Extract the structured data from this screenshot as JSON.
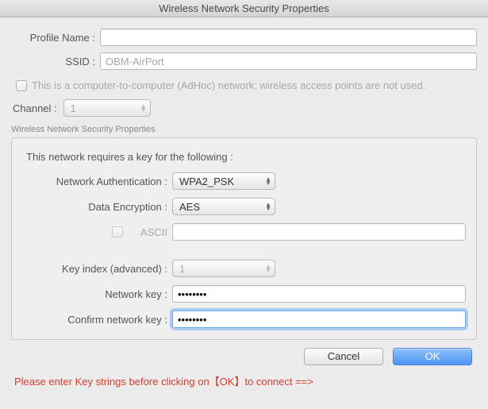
{
  "window": {
    "title": "Wireless Network Security Properties"
  },
  "top": {
    "profile_label": "Profile Name :",
    "profile_value": "",
    "ssid_label": "SSID :",
    "ssid_value": "OBM-AirPort",
    "adhoc_label": "This is a computer-to-computer (AdHoc) network; wireless access points are not used.",
    "channel_label": "Channel :",
    "channel_value": "1"
  },
  "group": {
    "title": "Wireless Network Security Properties",
    "intro": "This network requires a key for the following :",
    "auth_label": "Network Authentication :",
    "auth_value": "WPA2_PSK",
    "enc_label": "Data Encryption :",
    "enc_value": "AES",
    "ascii_label": "ASCII",
    "ascii_input": "",
    "keyidx_label": "Key index (advanced) :",
    "keyidx_value": "1",
    "netkey_label": "Network key :",
    "netkey_value": "••••••••",
    "confkey_label": "Confirm network key :",
    "confkey_value": "••••••••"
  },
  "buttons": {
    "cancel": "Cancel",
    "ok": "OK"
  },
  "footer": "Please enter Key strings before clicking on【OK】to connect ==>"
}
